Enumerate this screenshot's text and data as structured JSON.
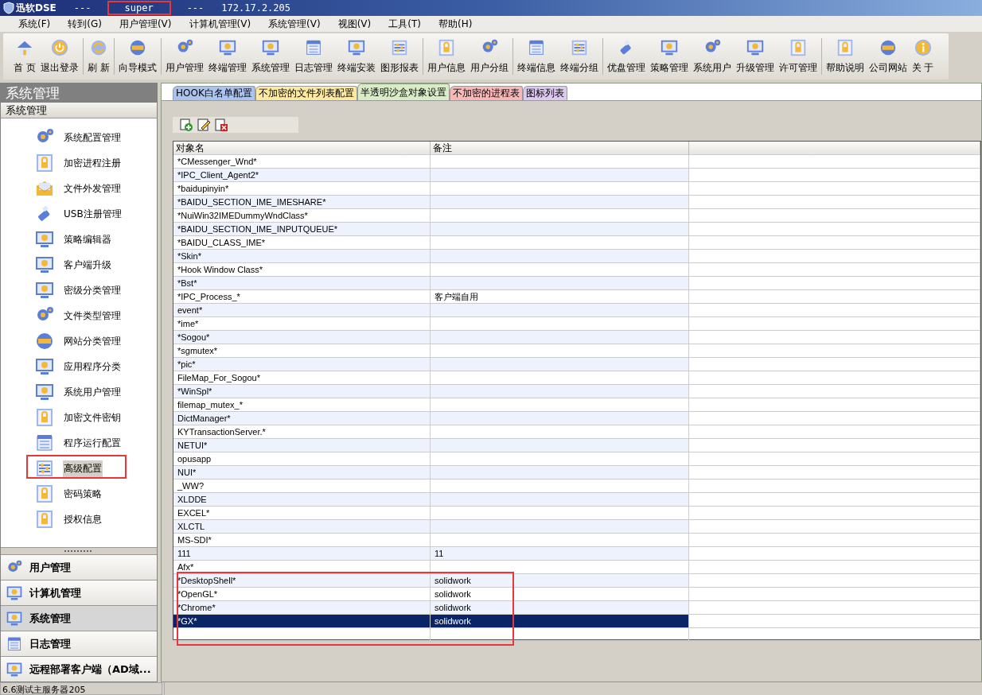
{
  "window": {
    "title": "迅软DSE",
    "separator_left": "---",
    "user": "super",
    "user_highlighted": true,
    "separator_right": "---",
    "address": "172.17.2.205"
  },
  "menu": [
    "系统(F)",
    "转到(G)",
    "用户管理(V)",
    "计算机管理(V)",
    "系统管理(V)",
    "视图(V)",
    "工具(T)",
    "帮助(H)"
  ],
  "toolbar": [
    [
      "首 页",
      "退出登录"
    ],
    [
      "刷 新"
    ],
    [
      "向导模式"
    ],
    [
      "用户管理",
      "终端管理",
      "系统管理",
      "日志管理",
      "终端安装",
      "图形报表"
    ],
    [
      "用户信息",
      "用户分组"
    ],
    [
      "终端信息",
      "终端分组"
    ],
    [
      "优盘管理",
      "策略管理",
      "系统用户",
      "升级管理",
      "许可管理"
    ],
    [
      "帮助说明",
      "公司网站",
      "关 于"
    ]
  ],
  "sidebar": {
    "title": "系统管理",
    "section": "系统管理",
    "items": [
      {
        "label": "系统配置管理",
        "selected": false,
        "highlighted": false
      },
      {
        "label": "加密进程注册",
        "selected": false,
        "highlighted": false
      },
      {
        "label": "文件外发管理",
        "selected": false,
        "highlighted": false
      },
      {
        "label": "USB注册管理",
        "selected": false,
        "highlighted": false
      },
      {
        "label": "策略编辑器",
        "selected": false,
        "highlighted": false
      },
      {
        "label": "客户端升级",
        "selected": false,
        "highlighted": false
      },
      {
        "label": "密级分类管理",
        "selected": false,
        "highlighted": false
      },
      {
        "label": "文件类型管理",
        "selected": false,
        "highlighted": false
      },
      {
        "label": "网站分类管理",
        "selected": false,
        "highlighted": false
      },
      {
        "label": "应用程序分类",
        "selected": false,
        "highlighted": false
      },
      {
        "label": "系统用户管理",
        "selected": false,
        "highlighted": false
      },
      {
        "label": "加密文件密钥",
        "selected": false,
        "highlighted": false
      },
      {
        "label": "程序运行配置",
        "selected": false,
        "highlighted": false
      },
      {
        "label": "高级配置",
        "selected": true,
        "highlighted": true
      },
      {
        "label": "密码策略",
        "selected": false,
        "highlighted": false
      },
      {
        "label": "授权信息",
        "selected": false,
        "highlighted": false
      }
    ],
    "groups": [
      {
        "label": "用户管理",
        "selected": false
      },
      {
        "label": "计算机管理",
        "selected": false
      },
      {
        "label": "系统管理",
        "selected": true
      },
      {
        "label": "日志管理",
        "selected": false
      },
      {
        "label": "远程部署客户端（AD域...",
        "selected": false
      }
    ]
  },
  "tabs": [
    {
      "label": "HOOK白名单配置",
      "color": "#a9c4f0",
      "selected": false
    },
    {
      "label": "不加密的文件列表配置",
      "color": "#fde9a0",
      "selected": false
    },
    {
      "label": "半透明沙盒对象设置",
      "color": "#d8ecc8",
      "selected": true
    },
    {
      "label": "不加密的进程表",
      "color": "#f8b8b8",
      "selected": false
    },
    {
      "label": "图标列表",
      "color": "#dcc8f0",
      "selected": false
    }
  ],
  "table": {
    "columns": [
      "对象名",
      "备注"
    ],
    "rows": [
      {
        "name": "*CMessenger_Wnd*",
        "note": "",
        "selected": false,
        "highlighted": false
      },
      {
        "name": "*IPC_Client_Agent2*",
        "note": "",
        "selected": false,
        "highlighted": false
      },
      {
        "name": "*baidupinyin*",
        "note": "",
        "selected": false,
        "highlighted": false
      },
      {
        "name": "*BAIDU_SECTION_IME_IMESHARE*",
        "note": "",
        "selected": false,
        "highlighted": false
      },
      {
        "name": "*NuiWin32IMEDummyWndClass*",
        "note": "",
        "selected": false,
        "highlighted": false
      },
      {
        "name": "*BAIDU_SECTION_IME_INPUTQUEUE*",
        "note": "",
        "selected": false,
        "highlighted": false
      },
      {
        "name": "*BAIDU_CLASS_IME*",
        "note": "",
        "selected": false,
        "highlighted": false
      },
      {
        "name": "*Skin*",
        "note": "",
        "selected": false,
        "highlighted": false
      },
      {
        "name": "*Hook Window Class*",
        "note": "",
        "selected": false,
        "highlighted": false
      },
      {
        "name": "*Bst*",
        "note": "",
        "selected": false,
        "highlighted": false
      },
      {
        "name": "*IPC_Process_*",
        "note": "客户端自用",
        "selected": false,
        "highlighted": false
      },
      {
        "name": "event*",
        "note": "",
        "selected": false,
        "highlighted": false
      },
      {
        "name": "*ime*",
        "note": "",
        "selected": false,
        "highlighted": false
      },
      {
        "name": "*Sogou*",
        "note": "",
        "selected": false,
        "highlighted": false
      },
      {
        "name": "*sgmutex*",
        "note": "",
        "selected": false,
        "highlighted": false
      },
      {
        "name": "*pic*",
        "note": "",
        "selected": false,
        "highlighted": false
      },
      {
        "name": "FileMap_For_Sogou*",
        "note": "",
        "selected": false,
        "highlighted": false
      },
      {
        "name": "*WinSpl*",
        "note": "",
        "selected": false,
        "highlighted": false
      },
      {
        "name": "filemap_mutex_*",
        "note": "",
        "selected": false,
        "highlighted": false
      },
      {
        "name": "DictManager*",
        "note": "",
        "selected": false,
        "highlighted": false
      },
      {
        "name": "KYTransactionServer.*",
        "note": "",
        "selected": false,
        "highlighted": false
      },
      {
        "name": "NETUI*",
        "note": "",
        "selected": false,
        "highlighted": false
      },
      {
        "name": "opusapp",
        "note": "",
        "selected": false,
        "highlighted": false
      },
      {
        "name": "NUI*",
        "note": "",
        "selected": false,
        "highlighted": false
      },
      {
        "name": "_WW?",
        "note": "",
        "selected": false,
        "highlighted": false
      },
      {
        "name": "XLDDE",
        "note": "",
        "selected": false,
        "highlighted": false
      },
      {
        "name": "EXCEL*",
        "note": "",
        "selected": false,
        "highlighted": false
      },
      {
        "name": "XLCTL",
        "note": "",
        "selected": false,
        "highlighted": false
      },
      {
        "name": "MS-SDI*",
        "note": "",
        "selected": false,
        "highlighted": false
      },
      {
        "name": "111",
        "note": "11",
        "selected": false,
        "highlighted": false
      },
      {
        "name": "Afx*",
        "note": "",
        "selected": false,
        "highlighted": false
      },
      {
        "name": "*DesktopShell*",
        "note": "solidwork",
        "selected": false,
        "highlighted": true
      },
      {
        "name": "*OpenGL*",
        "note": "solidwork",
        "selected": false,
        "highlighted": true
      },
      {
        "name": "*Chrome*",
        "note": "solidwork",
        "selected": false,
        "highlighted": true
      },
      {
        "name": "*GX*",
        "note": "solidwork",
        "selected": true,
        "highlighted": true
      }
    ]
  },
  "status_bar": {
    "server": "6.6测试主服务器205"
  }
}
